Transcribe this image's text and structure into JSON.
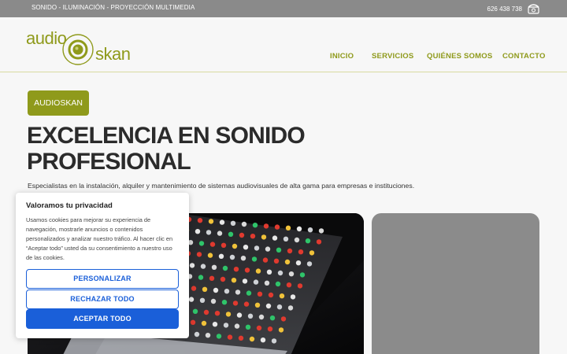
{
  "topbar": {
    "services": "SONIDO - ILUMINACIÓN - PROYECCIÓN MULTIMEDIA",
    "phone": "626 438 738",
    "phone_icon": "phone-icon"
  },
  "logo": {
    "word1": "audio",
    "word2": "skan",
    "color": "#8f9a1b"
  },
  "nav": {
    "items": [
      {
        "label": "INICIO"
      },
      {
        "label": "SERVICIOS"
      },
      {
        "label": "QUIÉNES SOMOS"
      },
      {
        "label": "CONTACTO"
      }
    ]
  },
  "hero": {
    "badge": "AUDIOSKAN",
    "title_line1": "EXCELENCIA EN SONIDO",
    "title_line2": "PROFESIONAL",
    "subtitle": "Especialistas en la instalación, alquiler y mantenimiento de sistemas audiovisuales de alta gama para empresas e instituciones."
  },
  "cookie": {
    "title": "Valoramos tu privacidad",
    "body": "Usamos cookies para mejorar su experiencia de navegación, mostrarle anuncios o contenidos personalizados y analizar nuestro tráfico. Al hacer clic en “Aceptar todo” usted da su consentimiento a nuestro uso de las cookies.",
    "customize": "PERSONALIZAR",
    "reject": "RECHAZAR TODO",
    "accept": "ACEPTAR TODO",
    "accent": "#1a5fd9"
  },
  "colors": {
    "brand": "#8f9a1b",
    "topbar": "#8a8a8a"
  }
}
